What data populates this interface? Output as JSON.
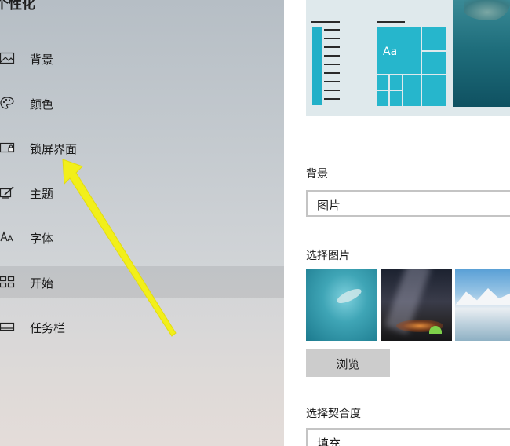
{
  "sidebar": {
    "title": "个性化",
    "items": [
      {
        "label": "背景",
        "icon": "picture-icon"
      },
      {
        "label": "颜色",
        "icon": "palette-icon"
      },
      {
        "label": "锁屏界面",
        "icon": "lock-screen-icon"
      },
      {
        "label": "主题",
        "icon": "theme-brush-icon"
      },
      {
        "label": "字体",
        "icon": "font-icon"
      },
      {
        "label": "开始",
        "icon": "start-grid-icon",
        "selected": true
      },
      {
        "label": "任务栏",
        "icon": "taskbar-icon"
      }
    ]
  },
  "main": {
    "preview": {
      "tile_text": "Aa"
    },
    "background": {
      "label": "背景",
      "value": "图片"
    },
    "choose_picture": {
      "label": "选择图片",
      "browse_label": "浏览"
    },
    "fit": {
      "label": "选择契合度",
      "value": "填充"
    }
  },
  "colors": {
    "accent": "#26b6cc",
    "annotation_arrow": "#f2ef1a"
  }
}
